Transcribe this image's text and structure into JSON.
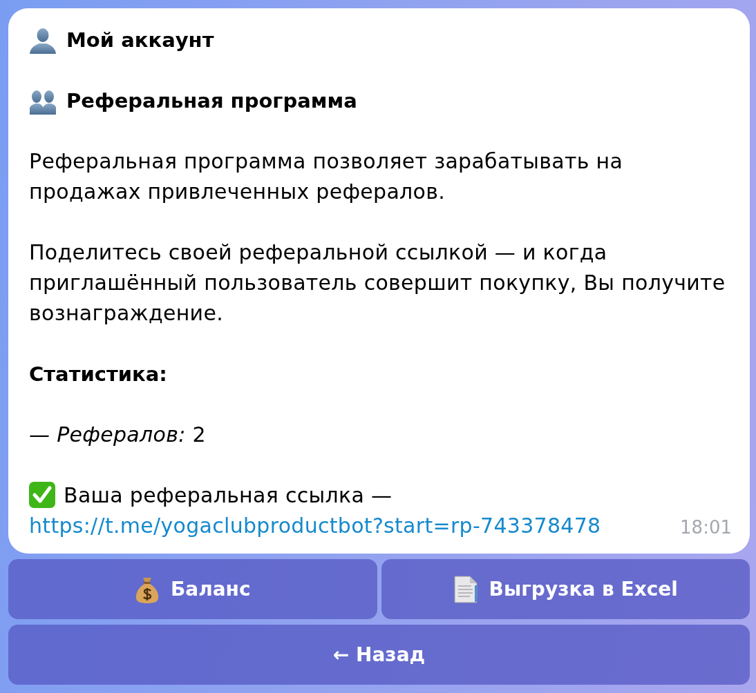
{
  "message": {
    "blocks": [
      {
        "kind": "title",
        "text": "Мой аккаунт"
      },
      {
        "kind": "section",
        "text": "Реферальная программа"
      },
      {
        "kind": "paragraph",
        "text": "Реферальная программа позволяет зарабатывать на продажах привлеченных рефералов."
      },
      {
        "kind": "paragraph",
        "text": "Поделитесь своей реферальной ссылкой — и когда приглашённый пользователь совершит покупку, Вы получите вознаграждение."
      },
      {
        "kind": "label",
        "text": "Статистика:"
      },
      {
        "kind": "paragraph",
        "text": "— *Рефералов:* 2"
      },
      {
        "kind": "link_line",
        "text": "Ваша реферальная ссылка —",
        "link": "https://t.me/yogaclubproductbot?start=rp-743378478"
      }
    ],
    "time": "18:01"
  },
  "keyboard": {
    "rows": [
      [
        {
          "kind": "balance",
          "label": "Баланс"
        },
        {
          "kind": "export",
          "label": "Выгрузка в Excel"
        }
      ],
      [
        {
          "kind": "back",
          "label": "← Назад"
        }
      ]
    ]
  }
}
